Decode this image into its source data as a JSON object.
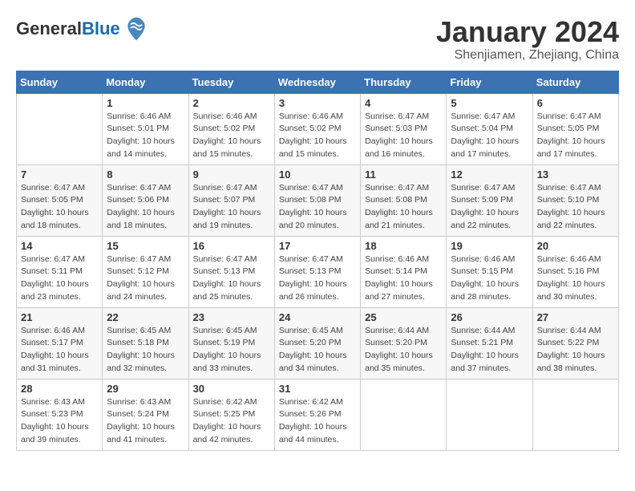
{
  "header": {
    "logo_general": "General",
    "logo_blue": "Blue",
    "month_title": "January 2024",
    "location": "Shenjiamen, Zhejiang, China"
  },
  "days_of_week": [
    "Sunday",
    "Monday",
    "Tuesday",
    "Wednesday",
    "Thursday",
    "Friday",
    "Saturday"
  ],
  "weeks": [
    [
      {
        "num": "",
        "info": ""
      },
      {
        "num": "1",
        "info": "Sunrise: 6:46 AM\nSunset: 5:01 PM\nDaylight: 10 hours\nand 14 minutes."
      },
      {
        "num": "2",
        "info": "Sunrise: 6:46 AM\nSunset: 5:02 PM\nDaylight: 10 hours\nand 15 minutes."
      },
      {
        "num": "3",
        "info": "Sunrise: 6:46 AM\nSunset: 5:02 PM\nDaylight: 10 hours\nand 15 minutes."
      },
      {
        "num": "4",
        "info": "Sunrise: 6:47 AM\nSunset: 5:03 PM\nDaylight: 10 hours\nand 16 minutes."
      },
      {
        "num": "5",
        "info": "Sunrise: 6:47 AM\nSunset: 5:04 PM\nDaylight: 10 hours\nand 17 minutes."
      },
      {
        "num": "6",
        "info": "Sunrise: 6:47 AM\nSunset: 5:05 PM\nDaylight: 10 hours\nand 17 minutes."
      }
    ],
    [
      {
        "num": "7",
        "info": "Sunrise: 6:47 AM\nSunset: 5:05 PM\nDaylight: 10 hours\nand 18 minutes."
      },
      {
        "num": "8",
        "info": "Sunrise: 6:47 AM\nSunset: 5:06 PM\nDaylight: 10 hours\nand 18 minutes."
      },
      {
        "num": "9",
        "info": "Sunrise: 6:47 AM\nSunset: 5:07 PM\nDaylight: 10 hours\nand 19 minutes."
      },
      {
        "num": "10",
        "info": "Sunrise: 6:47 AM\nSunset: 5:08 PM\nDaylight: 10 hours\nand 20 minutes."
      },
      {
        "num": "11",
        "info": "Sunrise: 6:47 AM\nSunset: 5:08 PM\nDaylight: 10 hours\nand 21 minutes."
      },
      {
        "num": "12",
        "info": "Sunrise: 6:47 AM\nSunset: 5:09 PM\nDaylight: 10 hours\nand 22 minutes."
      },
      {
        "num": "13",
        "info": "Sunrise: 6:47 AM\nSunset: 5:10 PM\nDaylight: 10 hours\nand 22 minutes."
      }
    ],
    [
      {
        "num": "14",
        "info": "Sunrise: 6:47 AM\nSunset: 5:11 PM\nDaylight: 10 hours\nand 23 minutes."
      },
      {
        "num": "15",
        "info": "Sunrise: 6:47 AM\nSunset: 5:12 PM\nDaylight: 10 hours\nand 24 minutes."
      },
      {
        "num": "16",
        "info": "Sunrise: 6:47 AM\nSunset: 5:13 PM\nDaylight: 10 hours\nand 25 minutes."
      },
      {
        "num": "17",
        "info": "Sunrise: 6:47 AM\nSunset: 5:13 PM\nDaylight: 10 hours\nand 26 minutes."
      },
      {
        "num": "18",
        "info": "Sunrise: 6:46 AM\nSunset: 5:14 PM\nDaylight: 10 hours\nand 27 minutes."
      },
      {
        "num": "19",
        "info": "Sunrise: 6:46 AM\nSunset: 5:15 PM\nDaylight: 10 hours\nand 28 minutes."
      },
      {
        "num": "20",
        "info": "Sunrise: 6:46 AM\nSunset: 5:16 PM\nDaylight: 10 hours\nand 30 minutes."
      }
    ],
    [
      {
        "num": "21",
        "info": "Sunrise: 6:46 AM\nSunset: 5:17 PM\nDaylight: 10 hours\nand 31 minutes."
      },
      {
        "num": "22",
        "info": "Sunrise: 6:45 AM\nSunset: 5:18 PM\nDaylight: 10 hours\nand 32 minutes."
      },
      {
        "num": "23",
        "info": "Sunrise: 6:45 AM\nSunset: 5:19 PM\nDaylight: 10 hours\nand 33 minutes."
      },
      {
        "num": "24",
        "info": "Sunrise: 6:45 AM\nSunset: 5:20 PM\nDaylight: 10 hours\nand 34 minutes."
      },
      {
        "num": "25",
        "info": "Sunrise: 6:44 AM\nSunset: 5:20 PM\nDaylight: 10 hours\nand 35 minutes."
      },
      {
        "num": "26",
        "info": "Sunrise: 6:44 AM\nSunset: 5:21 PM\nDaylight: 10 hours\nand 37 minutes."
      },
      {
        "num": "27",
        "info": "Sunrise: 6:44 AM\nSunset: 5:22 PM\nDaylight: 10 hours\nand 38 minutes."
      }
    ],
    [
      {
        "num": "28",
        "info": "Sunrise: 6:43 AM\nSunset: 5:23 PM\nDaylight: 10 hours\nand 39 minutes."
      },
      {
        "num": "29",
        "info": "Sunrise: 6:43 AM\nSunset: 5:24 PM\nDaylight: 10 hours\nand 41 minutes."
      },
      {
        "num": "30",
        "info": "Sunrise: 6:42 AM\nSunset: 5:25 PM\nDaylight: 10 hours\nand 42 minutes."
      },
      {
        "num": "31",
        "info": "Sunrise: 6:42 AM\nSunset: 5:26 PM\nDaylight: 10 hours\nand 44 minutes."
      },
      {
        "num": "",
        "info": ""
      },
      {
        "num": "",
        "info": ""
      },
      {
        "num": "",
        "info": ""
      }
    ]
  ]
}
